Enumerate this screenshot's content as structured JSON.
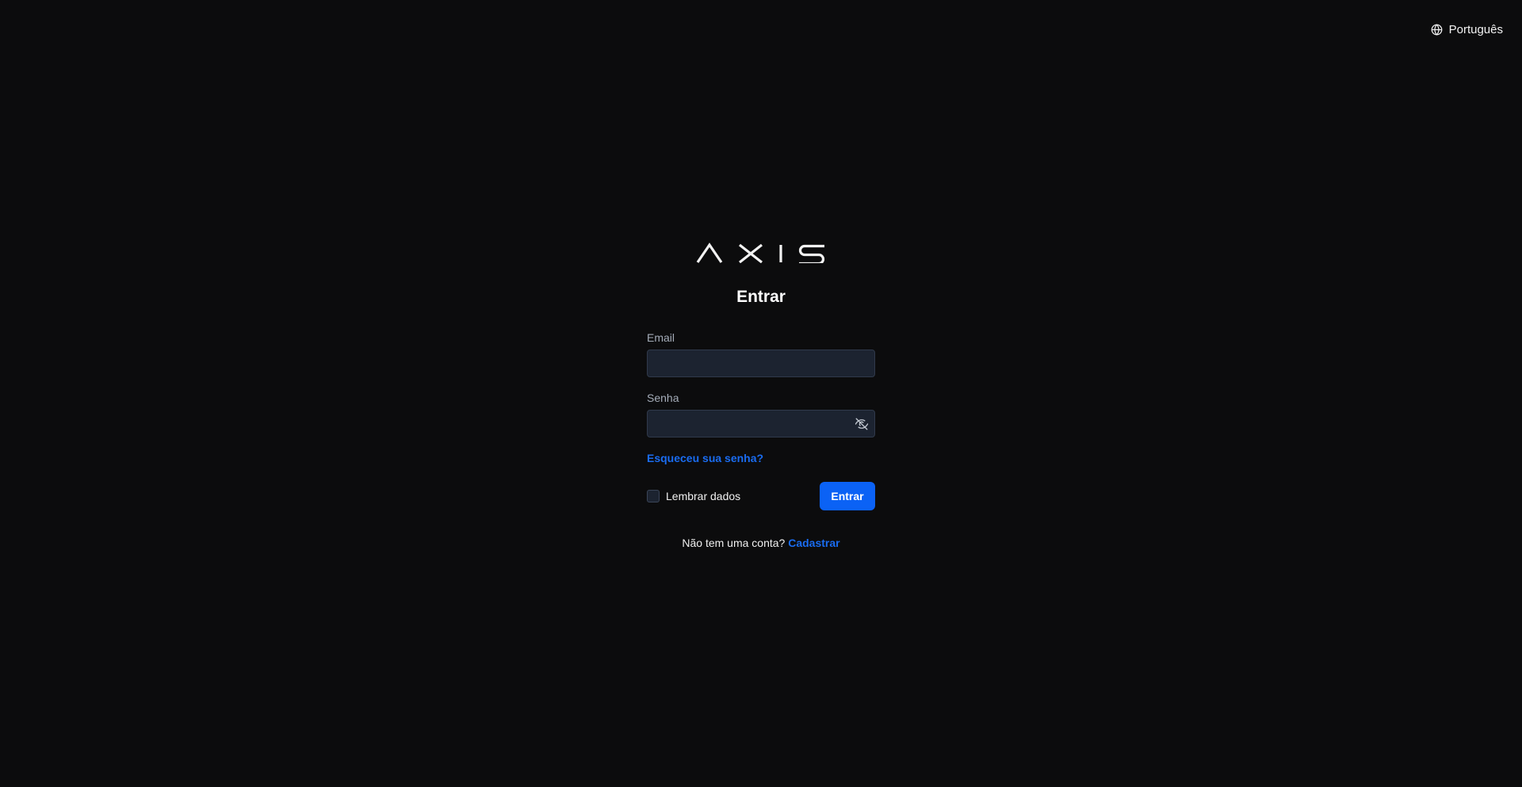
{
  "header": {
    "language_icon": "globe-icon",
    "language_label": "Português"
  },
  "brand": {
    "logo_text": "AXIS"
  },
  "login": {
    "title": "Entrar",
    "email_label": "Email",
    "email_value": "",
    "password_label": "Senha",
    "password_value": "",
    "password_toggle_icon": "eye-off-icon",
    "forgot_password": "Esqueceu sua senha?",
    "remember_label": "Lembrar dados",
    "remember_checked": false,
    "submit_label": "Entrar",
    "signup_prompt": "Não tem uma conta?",
    "signup_link": "Cadastrar"
  },
  "colors": {
    "background": "#0c0c0d",
    "input_background": "#1c2330",
    "accent": "#0b62f5",
    "link": "#1a6cf0"
  }
}
